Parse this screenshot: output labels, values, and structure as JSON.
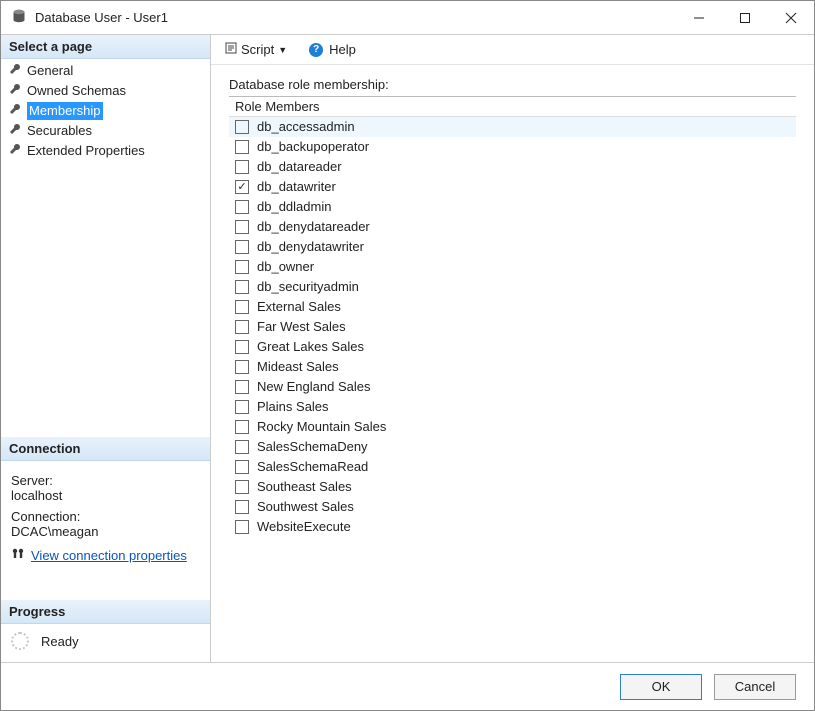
{
  "window": {
    "title": "Database User - User1"
  },
  "sidebar": {
    "select_page_header": "Select a page",
    "pages": [
      {
        "label": "General",
        "selected": false
      },
      {
        "label": "Owned Schemas",
        "selected": false
      },
      {
        "label": "Membership",
        "selected": true
      },
      {
        "label": "Securables",
        "selected": false
      },
      {
        "label": "Extended Properties",
        "selected": false
      }
    ],
    "connection_header": "Connection",
    "server_label": "Server:",
    "server_value": "localhost",
    "connection_label": "Connection:",
    "connection_value": "DCAC\\meagan",
    "view_conn_props": "View connection properties",
    "progress_header": "Progress",
    "progress_status": "Ready"
  },
  "toolbar": {
    "script_label": "Script",
    "help_label": "Help"
  },
  "main": {
    "section_label": "Database role membership:",
    "role_header": "Role Members",
    "roles": [
      {
        "label": "db_accessadmin",
        "checked": false,
        "highlight": true
      },
      {
        "label": "db_backupoperator",
        "checked": false
      },
      {
        "label": "db_datareader",
        "checked": false
      },
      {
        "label": "db_datawriter",
        "checked": true
      },
      {
        "label": "db_ddladmin",
        "checked": false
      },
      {
        "label": "db_denydatareader",
        "checked": false
      },
      {
        "label": "db_denydatawriter",
        "checked": false
      },
      {
        "label": "db_owner",
        "checked": false
      },
      {
        "label": "db_securityadmin",
        "checked": false
      },
      {
        "label": "External Sales",
        "checked": false
      },
      {
        "label": "Far West Sales",
        "checked": false
      },
      {
        "label": "Great Lakes Sales",
        "checked": false
      },
      {
        "label": "Mideast Sales",
        "checked": false
      },
      {
        "label": "New England Sales",
        "checked": false
      },
      {
        "label": "Plains Sales",
        "checked": false
      },
      {
        "label": "Rocky Mountain Sales",
        "checked": false
      },
      {
        "label": "SalesSchemaDeny",
        "checked": false
      },
      {
        "label": "SalesSchemaRead",
        "checked": false
      },
      {
        "label": "Southeast Sales",
        "checked": false
      },
      {
        "label": "Southwest Sales",
        "checked": false
      },
      {
        "label": "WebsiteExecute",
        "checked": false
      }
    ]
  },
  "footer": {
    "ok_label": "OK",
    "cancel_label": "Cancel"
  }
}
